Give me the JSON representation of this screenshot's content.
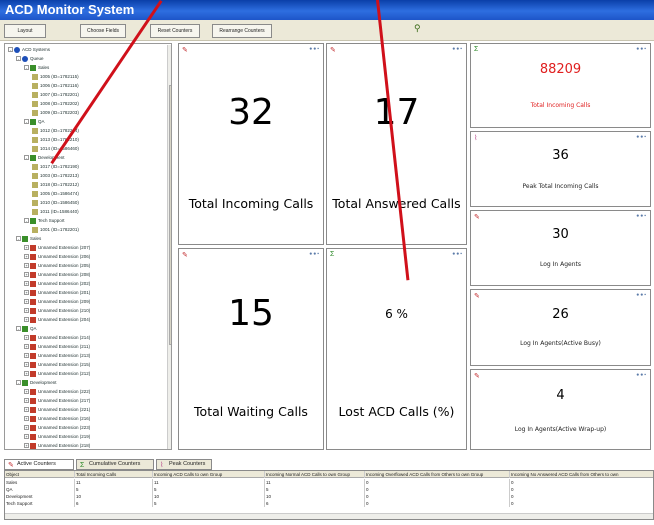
{
  "window": {
    "title": "ACD Monitor System"
  },
  "toolbar": {
    "buttons": [
      "Layout",
      "Choose Fields",
      "Reset Counters",
      "Rearrange Counters"
    ]
  },
  "tree": {
    "rows": [
      {
        "text": "ACD Systems",
        "type": "q",
        "exp": "-"
      },
      {
        "text": "Queue",
        "type": "q",
        "exp": "-"
      },
      {
        "text": "Sales",
        "type": "grp",
        "exp": "-"
      },
      {
        "text": "1005 (ID=1782115)",
        "type": "ag",
        "exp": ""
      },
      {
        "text": "1006 (ID=1782116)",
        "type": "ag",
        "exp": ""
      },
      {
        "text": "1007 (ID=1782201)",
        "type": "ag",
        "exp": ""
      },
      {
        "text": "1008 (ID=1782202)",
        "type": "ag",
        "exp": ""
      },
      {
        "text": "1009 (ID=1782203)",
        "type": "ag",
        "exp": ""
      },
      {
        "text": "QA",
        "type": "grp",
        "exp": "-"
      },
      {
        "text": "1012 (ID=1782204)",
        "type": "ag",
        "exp": ""
      },
      {
        "text": "1013 (ID=1782210)",
        "type": "ag",
        "exp": ""
      },
      {
        "text": "1014 (ID=1586460)",
        "type": "ag",
        "exp": ""
      },
      {
        "text": "Development",
        "type": "grp",
        "exp": "-"
      },
      {
        "text": "1017 (ID=1782190)",
        "type": "ag",
        "exp": ""
      },
      {
        "text": "1003 (ID=1782213)",
        "type": "ag",
        "exp": ""
      },
      {
        "text": "1018 (ID=1782212)",
        "type": "ag",
        "exp": ""
      },
      {
        "text": "1005 (ID=1586474)",
        "type": "ag",
        "exp": ""
      },
      {
        "text": "1010 (ID=1586450)",
        "type": "ag",
        "exp": ""
      },
      {
        "text": "1011 (ID=1586440)",
        "type": "ag",
        "exp": ""
      },
      {
        "text": "Tech Support",
        "type": "grp",
        "exp": "-"
      },
      {
        "text": "1001 (ID=1782201)",
        "type": "ag",
        "exp": ""
      },
      {
        "text": "Sales",
        "type": "grp",
        "exp": "-"
      },
      {
        "text": "Unnamed Extension (207)",
        "type": "ext",
        "exp": "+"
      },
      {
        "text": "Unnamed Extension (206)",
        "type": "ext",
        "exp": "+"
      },
      {
        "text": "Unnamed Extension (205)",
        "type": "ext",
        "exp": "+"
      },
      {
        "text": "Unnamed Extension (208)",
        "type": "ext",
        "exp": "+"
      },
      {
        "text": "Unnamed Extension (202)",
        "type": "ext",
        "exp": "+"
      },
      {
        "text": "Unnamed Extension (201)",
        "type": "ext",
        "exp": "+"
      },
      {
        "text": "Unnamed Extension (209)",
        "type": "ext",
        "exp": "+"
      },
      {
        "text": "Unnamed Extension (210)",
        "type": "ext",
        "exp": "+"
      },
      {
        "text": "Unnamed Extension (204)",
        "type": "ext",
        "exp": "+"
      },
      {
        "text": "QA",
        "type": "grp",
        "exp": "-"
      },
      {
        "text": "Unnamed Extension (214)",
        "type": "ext",
        "exp": "+"
      },
      {
        "text": "Unnamed Extension (211)",
        "type": "ext",
        "exp": "+"
      },
      {
        "text": "Unnamed Extension (213)",
        "type": "ext",
        "exp": "+"
      },
      {
        "text": "Unnamed Extension (215)",
        "type": "ext",
        "exp": "+"
      },
      {
        "text": "Unnamed Extension (212)",
        "type": "ext",
        "exp": "+"
      },
      {
        "text": "Development",
        "type": "grp",
        "exp": "-"
      },
      {
        "text": "Unnamed Extension (222)",
        "type": "ext",
        "exp": "+"
      },
      {
        "text": "Unnamed Extension (217)",
        "type": "ext",
        "exp": "+"
      },
      {
        "text": "Unnamed Extension (221)",
        "type": "ext",
        "exp": "+"
      },
      {
        "text": "Unnamed Extension (216)",
        "type": "ext",
        "exp": "+"
      },
      {
        "text": "Unnamed Extension (223)",
        "type": "ext",
        "exp": "+"
      },
      {
        "text": "Unnamed Extension (219)",
        "type": "ext",
        "exp": "+"
      },
      {
        "text": "Unnamed Extension (218)",
        "type": "ext",
        "exp": "+"
      }
    ]
  },
  "panels": {
    "total_incoming": {
      "value": "32",
      "label": "Total Incoming Calls"
    },
    "total_answered": {
      "value": "17",
      "label": "Total Answered Calls"
    },
    "total_waiting": {
      "value": "15",
      "label": "Total Waiting Calls"
    },
    "lost_acd": {
      "value": "6 %",
      "label": "Lost ACD Calls (%)"
    }
  },
  "side_panels": [
    {
      "value": "88209",
      "label": "Total Incoming Calls",
      "color": "#e02020"
    },
    {
      "value": "36",
      "label": "Peak Total Incoming Calls",
      "color": "#000000"
    },
    {
      "value": "30",
      "label": "Log In Agents",
      "color": "#000000"
    },
    {
      "value": "26",
      "label": "Log In Agents(Active Busy)",
      "color": "#000000"
    },
    {
      "value": "4",
      "label": "Log In Agents(Active Wrap-up)",
      "color": "#000000"
    }
  ],
  "tabs": [
    "Active Counters",
    "Cumulative Counters",
    "Peak Counters"
  ],
  "table": {
    "headers": [
      "Object",
      "Total Incoming Calls",
      "Incoming ACD Calls to own Group",
      "Incoming Normal ACD Calls to own Group",
      "Incoming Overflowed ACD Calls from Others to own Group",
      "Incoming No Answered ACD Calls from Others to own"
    ],
    "rows": [
      [
        "Sales",
        "11",
        "11",
        "11",
        "0",
        "0"
      ],
      [
        "QA",
        "5",
        "5",
        "5",
        "0",
        "0"
      ],
      [
        "Development",
        "10",
        "10",
        "10",
        "0",
        "0"
      ],
      [
        "Tech Support",
        "6",
        "5",
        "6",
        "0",
        "0"
      ]
    ]
  },
  "colors": {
    "accent": "#2e6ee0",
    "annotation_arrow": "#d0101a",
    "highlight_value": "#e02020"
  }
}
